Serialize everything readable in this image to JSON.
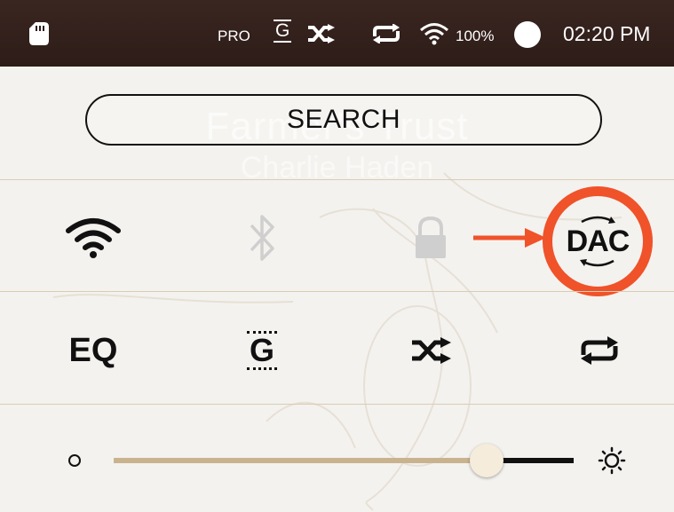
{
  "status_bar": {
    "sd_icon": "sd-card-icon",
    "pro_label": "PRO",
    "gapless_label": "G",
    "shuffle_icon": "shuffle-icon",
    "repeat_icon": "repeat-icon",
    "wifi_icon": "wifi-icon",
    "battery_percent": "100%",
    "battery_icon": "battery-circle-icon",
    "time": "02:20 PM"
  },
  "search": {
    "label": "SEARCH"
  },
  "background": {
    "title": "Farmer's Trust",
    "artist": "Charlie Haden"
  },
  "quick_settings": {
    "row1": [
      {
        "name": "wifi",
        "icon": "wifi-icon",
        "state": "on"
      },
      {
        "name": "bluetooth",
        "icon": "bluetooth-icon",
        "state": "off"
      },
      {
        "name": "lock",
        "icon": "lock-icon",
        "state": "off"
      },
      {
        "name": "dac",
        "label": "DAC",
        "icon": "dac-icon",
        "highlighted": true
      }
    ],
    "row2": [
      {
        "name": "eq",
        "label": "EQ"
      },
      {
        "name": "gapless",
        "label": "G"
      },
      {
        "name": "shuffle",
        "icon": "shuffle-icon"
      },
      {
        "name": "repeat",
        "icon": "repeat-icon"
      }
    ]
  },
  "brightness": {
    "min_icon": "brightness-low-icon",
    "max_icon": "brightness-high-icon",
    "level": 0.81
  },
  "colors": {
    "status_bar": "#2d1c18",
    "highlight": "#f0522a",
    "slider_fill": "#c9b38f",
    "divider": "#d9ccb5"
  }
}
